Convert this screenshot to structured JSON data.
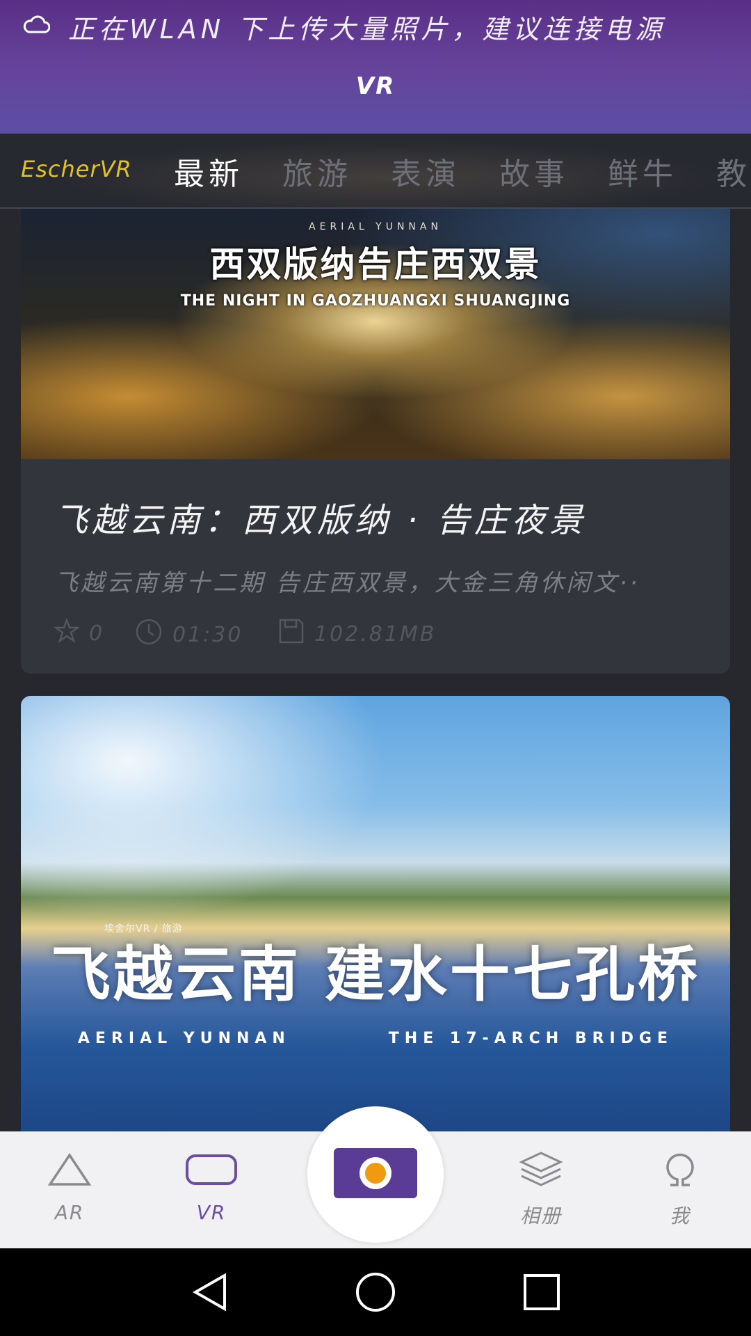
{
  "notification": {
    "icon": "cloud-icon",
    "text": "正在WLAN 下上传大量照片，建议连接电源"
  },
  "header": {
    "title": "VR"
  },
  "tabs": {
    "brand": "EscherVR",
    "items": [
      "最新",
      "旅游",
      "表演",
      "故事",
      "鲜牛",
      "教"
    ],
    "active_index": 0
  },
  "cards": [
    {
      "thumbnail": {
        "kicker": "AERIAL YUNNAN",
        "overlay_title": "西双版纳告庄西双景",
        "overlay_subtitle": "THE NIGHT IN GAOZHUANGXI SHUANGJING"
      },
      "title": "飞越云南：西双版纳 · 告庄夜景",
      "description": "飞越云南第十二期 告庄西双景，大金三角休闲文··",
      "favorites": "0",
      "duration": "01:30",
      "size": "102.81MB"
    },
    {
      "thumbnail": {
        "kicker": "埃舍尔VR / 旅游",
        "overlay_title": "飞越云南 建水十七孔桥",
        "overlay_subtitle_left": "AERIAL YUNNAN",
        "overlay_subtitle_right": "THE 17-ARCH BRIDGE"
      }
    }
  ],
  "bottom_nav": {
    "items": [
      {
        "label": "AR",
        "icon": "triangle-icon"
      },
      {
        "label": "VR",
        "icon": "rounded-rect-icon"
      },
      {
        "label": "相册",
        "icon": "layers-icon"
      },
      {
        "label": "我",
        "icon": "omega-icon"
      }
    ],
    "active_index": 1,
    "capture_icon": "camera-icon"
  },
  "colors": {
    "header_purple": "#5a2f86",
    "brand_yellow": "#e3c226",
    "accent_purple": "#6a4ea3",
    "capture_orange": "#f29a0f"
  },
  "system_nav": [
    "back-icon",
    "home-icon",
    "recents-icon"
  ]
}
